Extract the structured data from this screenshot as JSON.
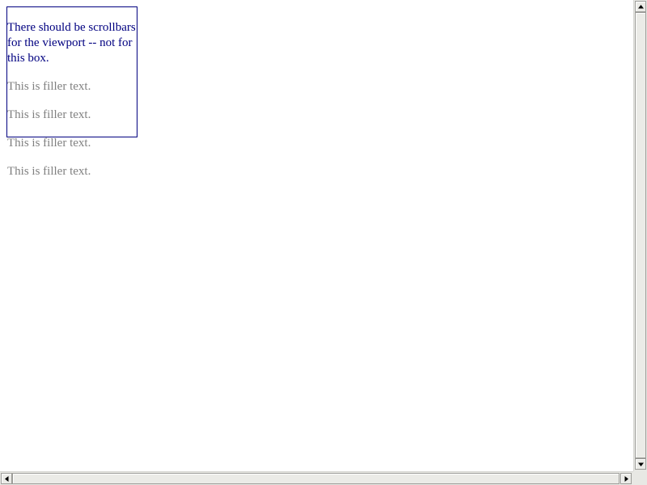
{
  "content": {
    "intro": "There should be scrollbars for the viewport -- not for this box.",
    "filler": [
      "This is filler text.",
      "This is filler text.",
      "This is filler text.",
      "This is filler text."
    ]
  },
  "scrollbars": {
    "vertical": {
      "icons": [
        "arrow-up-icon",
        "arrow-down-icon"
      ]
    },
    "horizontal": {
      "icons": [
        "arrow-left-icon",
        "arrow-right-icon"
      ]
    }
  },
  "colors": {
    "box_border": "#000080",
    "intro_text": "#000080",
    "filler_text": "#808080"
  }
}
